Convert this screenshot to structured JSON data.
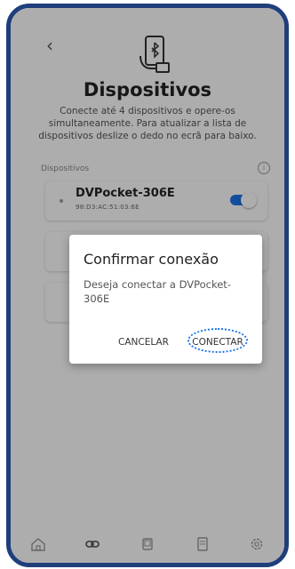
{
  "header": {
    "back_icon": "chevron-left-icon",
    "app_icon": "phone-bluetooth-icon",
    "title": "Dispositivos",
    "description": "Conecte até 4 dispositivos e opere-os simultaneamente. Para atualizar a lista de dispositivos deslize o dedo no ecrã para baixo."
  },
  "section_label": "Dispositivos",
  "devices": [
    {
      "name": "DVPocket-306E",
      "mac": "98:D3:AC:51:03:6E",
      "enabled": true
    }
  ],
  "dialog": {
    "title": "Confirmar conexão",
    "body": "Deseja conectar a DVPocket-306E",
    "cancel_label": "CANCELAR",
    "confirm_label": "CONECTAR"
  },
  "nav": [
    "home-icon",
    "link-icon",
    "device-icon",
    "document-icon",
    "settings-icon"
  ],
  "colors": {
    "frame": "#1f3e7a",
    "accent": "#1a73e8",
    "overlay": "rgba(0,0,0,0.32)"
  }
}
